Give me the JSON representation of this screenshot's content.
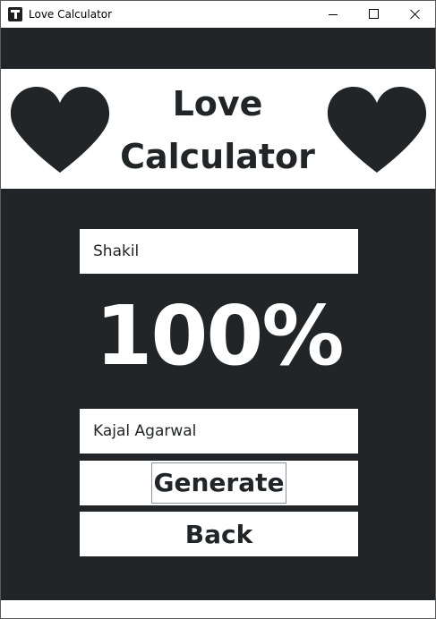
{
  "window": {
    "title": "Love Calculator",
    "controls": [
      "minimize",
      "maximize",
      "close"
    ]
  },
  "header": {
    "heading_line1": "Love",
    "heading_line2": "Calculator",
    "left_icon": "heart-icon",
    "right_icon": "heart-icon"
  },
  "form": {
    "first_name_value": "Shakil",
    "result_text": "100%",
    "second_name_value": "Kajal Agarwal",
    "generate_label": "Generate",
    "back_label": "Back"
  },
  "colors": {
    "background_dark": "#212527",
    "panel_white": "#ffffff",
    "heart": "#212527",
    "text_dark": "#212527",
    "result_text": "#ffffff"
  }
}
